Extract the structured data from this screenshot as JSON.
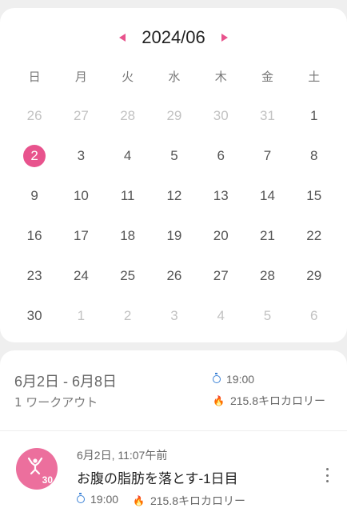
{
  "calendar": {
    "month_label": "2024/06",
    "weekdays": [
      "日",
      "月",
      "火",
      "水",
      "木",
      "金",
      "土"
    ],
    "weeks": [
      [
        "26",
        "27",
        "28",
        "29",
        "30",
        "31",
        "1"
      ],
      [
        "2",
        "3",
        "4",
        "5",
        "6",
        "7",
        "8"
      ],
      [
        "9",
        "10",
        "11",
        "12",
        "13",
        "14",
        "15"
      ],
      [
        "16",
        "17",
        "18",
        "19",
        "20",
        "21",
        "22"
      ],
      [
        "23",
        "24",
        "25",
        "26",
        "27",
        "28",
        "29"
      ],
      [
        "30",
        "1",
        "2",
        "3",
        "4",
        "5",
        "6"
      ]
    ],
    "outside_month": [
      [
        0,
        0
      ],
      [
        0,
        1
      ],
      [
        0,
        2
      ],
      [
        0,
        3
      ],
      [
        0,
        4
      ],
      [
        0,
        5
      ],
      [
        5,
        1
      ],
      [
        5,
        2
      ],
      [
        5,
        3
      ],
      [
        5,
        4
      ],
      [
        5,
        5
      ],
      [
        5,
        6
      ]
    ],
    "selected": [
      1,
      0
    ],
    "accent_color": "#e8538d"
  },
  "summary": {
    "range": "6月2日 - 6月8日",
    "count": "1 ワークアウト",
    "time": "19:00",
    "calories": "215.8キロカロリー"
  },
  "workout": {
    "date": "6月2日, 11:07午前",
    "title": "お腹の脂肪を落とす-1日目",
    "time": "19:00",
    "calories": "215.8キロカロリー",
    "badge": "30",
    "icon": "abs-workout-icon"
  }
}
